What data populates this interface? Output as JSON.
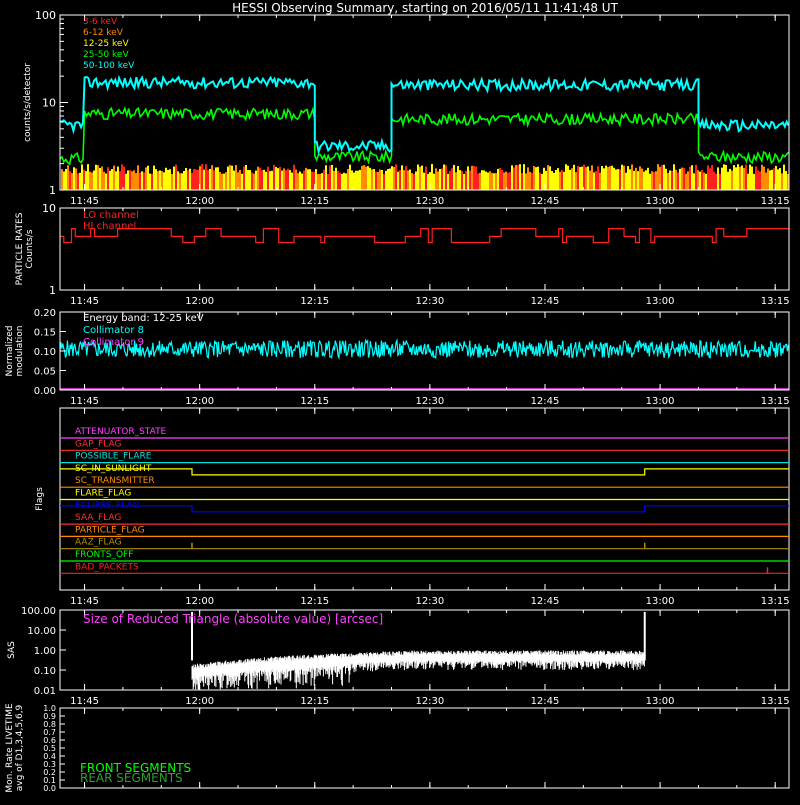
{
  "page": {
    "title": "HESSI Observing Summary, starting on 2016/05/11 11:41:48 UT"
  },
  "colors": {
    "background": "#000000",
    "axes": "#ffffff",
    "band_3_6": "#ff2020",
    "band_6_12": "#ff8c00",
    "band_12_25": "#ffff00",
    "band_25_50": "#00ff00",
    "band_50_100": "#00ffff",
    "particle": "#ff2020",
    "modulation": "#00ffff",
    "magenta": "#ff40ff",
    "sas": "#ffffff",
    "front_segments": "#00ff00",
    "rear_segments": "#2ea02e"
  },
  "chart_data": [
    {
      "id": "lightcurves",
      "type": "line",
      "ylabel": "counts/s/detector",
      "yscale": "log",
      "ylim": [
        1,
        100
      ],
      "yticks": [
        "100",
        "10",
        "1"
      ],
      "x_range_minutes": [
        701.8,
        796.8
      ],
      "xticks": [
        "11:45",
        "12:00",
        "12:15",
        "12:30",
        "12:45",
        "13:00",
        "13:15"
      ],
      "series": [
        {
          "name": "3-6 keV",
          "color_key": "band_3_6",
          "segments": [
            {
              "from": "11:41:48",
              "to": "13:16:48",
              "level": 1.2
            }
          ]
        },
        {
          "name": "6-12 keV",
          "color_key": "band_6_12",
          "segments": [
            {
              "from": "11:41:48",
              "to": "13:16:48",
              "level": 1.6
            }
          ]
        },
        {
          "name": "12-25 keV",
          "color_key": "band_12_25",
          "segments": [
            {
              "from": "11:41:48",
              "to": "13:16:48",
              "level": 2.0
            }
          ]
        },
        {
          "name": "25-50 keV",
          "values": [
            {
              "from": "11:41:48",
              "to": "11:45",
              "level": 2.3
            },
            {
              "from": "11:45",
              "to": "12:15",
              "level": 7.5
            },
            {
              "from": "12:15",
              "to": "12:25",
              "level": 2.4
            },
            {
              "from": "12:25",
              "to": "13:05",
              "level": 6.5
            },
            {
              "from": "13:05",
              "to": "13:16:48",
              "level": 2.4
            }
          ],
          "color_key": "band_25_50"
        },
        {
          "name": "50-100 keV",
          "values": [
            {
              "from": "11:41:48",
              "to": "11:45",
              "level": 5.5
            },
            {
              "from": "11:45",
              "to": "12:15",
              "level": 17
            },
            {
              "from": "12:15",
              "to": "12:25",
              "level": 3.2
            },
            {
              "from": "12:25",
              "to": "13:05",
              "level": 16
            },
            {
              "from": "13:05",
              "to": "13:16:48",
              "level": 5.5
            }
          ],
          "color_key": "band_50_100"
        }
      ]
    },
    {
      "id": "particle",
      "type": "line",
      "ylabel": "PARTICLE RATES Counts/s",
      "yscale": "log",
      "ylim": [
        1,
        10
      ],
      "yticks": [
        "10",
        "1"
      ],
      "xticks": [
        "11:45",
        "12:00",
        "12:15",
        "12:30",
        "12:45",
        "13:00",
        "13:15"
      ],
      "series": [
        {
          "name": "LO channel",
          "color_key": "particle",
          "level": 4.5
        },
        {
          "name": "HI channel",
          "color_key": "particle",
          "level": 4.5
        }
      ]
    },
    {
      "id": "modulation",
      "type": "line",
      "ylabel": "Normalized modulation",
      "ylim": [
        0.0,
        0.2
      ],
      "yticks": [
        "0.20",
        "0.15",
        "0.10",
        "0.05",
        "0.00"
      ],
      "xticks": [
        "11:45",
        "12:00",
        "12:15",
        "12:30",
        "12:45",
        "13:00",
        "13:15"
      ],
      "annotation": "Energy band: 12-25 keV",
      "series": [
        {
          "name": "Collimator 8",
          "color_key": "modulation",
          "level": 0.105
        },
        {
          "name": "Collimator 9",
          "color_key": "magenta",
          "level": 0.0
        }
      ]
    },
    {
      "id": "flags",
      "type": "line",
      "ylabel": "Flags",
      "xticks": [
        "11:45",
        "12:00",
        "12:15",
        "12:30",
        "12:45",
        "13:00",
        "13:15"
      ],
      "flags": [
        {
          "name": "ATTENUATOR_STATE",
          "color": "#ff40ff"
        },
        {
          "name": "GAP_FLAG",
          "color": "#ff3030"
        },
        {
          "name": "POSSIBLE_FLARE",
          "color": "#00e0e0"
        },
        {
          "name": "SC_IN_SUNLIGHT",
          "color": "#ffff00",
          "high": [
            [
              "11:41:48",
              "11:59"
            ],
            [
              "12:58",
              "13:16:48"
            ]
          ],
          "low": [
            [
              "11:59",
              "12:58"
            ]
          ]
        },
        {
          "name": "SC_TRANSMITTER",
          "color": "#ff8c00"
        },
        {
          "name": "FLARE_FLAG",
          "color": "#ffff00"
        },
        {
          "name": "ECLIPSE_FLAG",
          "color": "#0000ff",
          "high": [
            [
              "11:41:48",
              "11:59"
            ],
            [
              "12:58",
              "13:16:48"
            ]
          ],
          "low": [
            [
              "11:59",
              "12:58"
            ]
          ]
        },
        {
          "name": "SAA_FLAG",
          "color": "#ff3030"
        },
        {
          "name": "PARTICLE_FLAG",
          "color": "#ff8c00"
        },
        {
          "name": "AAZ_FLAG",
          "color": "#b09000",
          "spikes": [
            "11:59",
            "12:58"
          ]
        },
        {
          "name": "FRONTS_OFF",
          "color": "#00ff00"
        },
        {
          "name": "BAD_PACKETS",
          "color": "#ff2020",
          "spikes": [
            "13:14"
          ]
        }
      ]
    },
    {
      "id": "sas",
      "type": "line",
      "ylabel": "SAS",
      "yscale": "log",
      "ylim": [
        0.01,
        100.0
      ],
      "yticks": [
        "100.00",
        "10.00",
        "1.00",
        "0.10",
        "0.01"
      ],
      "xticks": [
        "11:45",
        "12:00",
        "12:15",
        "12:30",
        "12:45",
        "13:00",
        "13:15"
      ],
      "annotation": "Size of Reduced Triangle (absolute value) [arcsec]",
      "series": [
        {
          "name": "SAS triangle",
          "color_key": "sas",
          "from": "11:59",
          "to": "12:58",
          "start_level": 0.1,
          "end_level": 0.5
        }
      ]
    },
    {
      "id": "livetime",
      "type": "line",
      "ylabel": "Mon. Rate LIVETIME avg of D1,3,4,5,6,9",
      "ylim": [
        0.0,
        1.0
      ],
      "yticks": [
        "1.0",
        "0.9",
        "0.8",
        "0.7",
        "0.6",
        "0.5",
        "0.4",
        "0.3",
        "0.2",
        "0.1",
        "0.0"
      ],
      "series": [
        {
          "name": "FRONT SEGMENTS",
          "color_key": "front_segments"
        },
        {
          "name": "REAR SEGMENTS",
          "color_key": "rear_segments"
        }
      ]
    }
  ]
}
